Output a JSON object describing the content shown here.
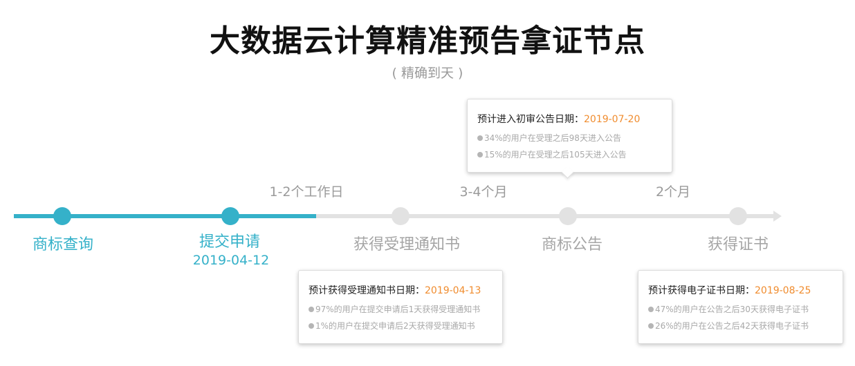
{
  "header": {
    "title": "大数据云计算精准预告拿证节点",
    "subtitle": "( 精确到天 )"
  },
  "timeline": {
    "progress_percent": 40,
    "durations": [
      "1-2个工作日",
      "3-4个月",
      "2个月"
    ],
    "steps": [
      {
        "label": "商标查询",
        "date": "",
        "status": "done"
      },
      {
        "label": "提交申请",
        "date": "2019-04-12",
        "status": "done"
      },
      {
        "label": "获得受理通知书",
        "date": "",
        "status": "pending"
      },
      {
        "label": "商标公告",
        "date": "",
        "status": "pending"
      },
      {
        "label": "获得证书",
        "date": "",
        "status": "pending"
      }
    ]
  },
  "cards": {
    "acceptance": {
      "head_label": "预计获得受理通知书日期：",
      "head_date": "2019-04-13",
      "notes": [
        "97%的用户在提交申请后1天获得受理通知书",
        "1%的用户在提交申请后2天获得受理通知书"
      ]
    },
    "announcement": {
      "head_label": "预计进入初审公告日期：",
      "head_date": "2019-07-20",
      "notes": [
        "34%的用户在受理之后98天进入公告",
        "15%的用户在受理之后105天进入公告"
      ]
    },
    "certificate": {
      "head_label": "预计获得电子证书日期：",
      "head_date": "2019-08-25",
      "notes": [
        "47%的用户在公告之后30天获得电子证书",
        "26%的用户在公告之后42天获得电子证书"
      ]
    }
  },
  "colors": {
    "accent": "#35b1c9",
    "date_highlight": "#f08c2e",
    "inactive": "#e2e2e2",
    "muted_text": "#9a9a9a"
  }
}
